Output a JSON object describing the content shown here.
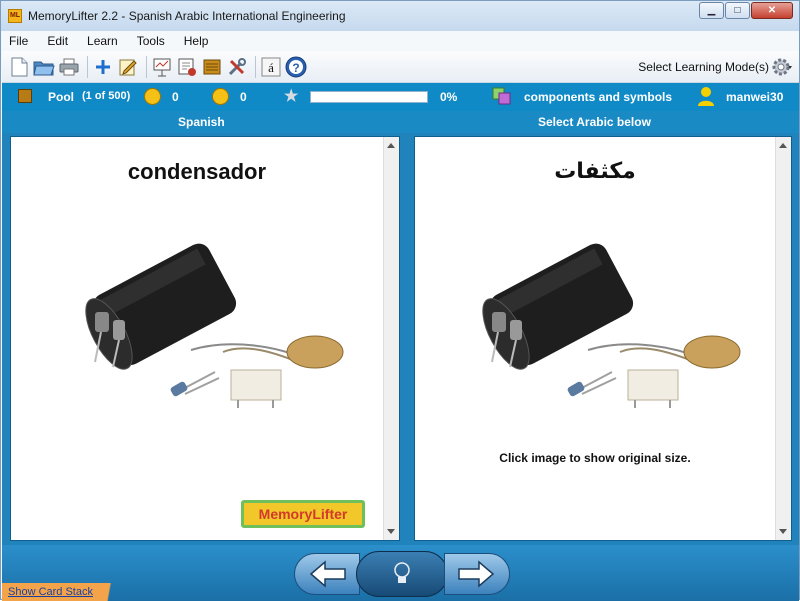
{
  "window": {
    "title": "MemoryLifter 2.2 - Spanish Arabic International Engineering",
    "app_icon_text": "ML"
  },
  "menu": [
    "File",
    "Edit",
    "Learn",
    "Tools",
    "Help"
  ],
  "toolbar": {
    "icons": [
      "new-icon",
      "open-icon",
      "print-icon",
      "add-card-icon",
      "edit-icon",
      "presentation-icon",
      "card-settings-icon",
      "card-stack-icon",
      "options-icon",
      "character-map-icon",
      "help-icon"
    ],
    "character_map_glyph": "á",
    "help_glyph": "?",
    "learning_mode_label": "Select Learning Mode(s)"
  },
  "status": {
    "box_label": "Pool",
    "box_count": "(1 of 500)",
    "correct_count": "0",
    "wrong_count": "0",
    "progress_percent": "0%",
    "progress_fraction": 0,
    "chapter": "components and symbols",
    "user": "manwei30"
  },
  "question": {
    "header": "Spanish",
    "word": "condensador",
    "logo_text_1": "Memory",
    "logo_text_2": "Lifter"
  },
  "answer": {
    "header": "Select Arabic below",
    "word": "مكثفات",
    "image_hint": "Click image to show original size."
  },
  "bottom": {
    "show_card_stack": "Show Card Stack"
  }
}
